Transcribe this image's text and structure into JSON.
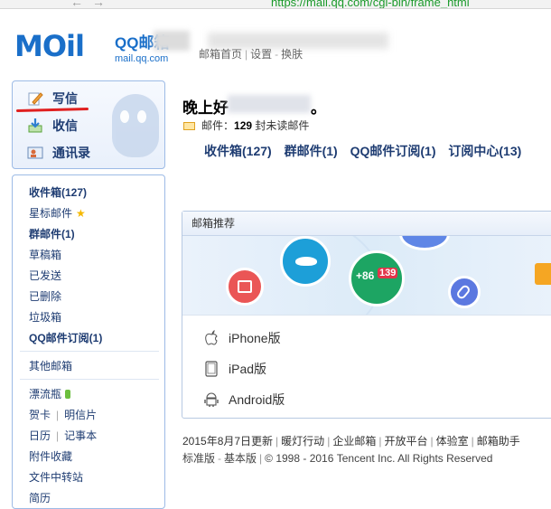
{
  "browser": {
    "url": "https://mail.qq.com/cgi-bin/frame_html"
  },
  "header": {
    "logo_text": "MOil",
    "brand_title": "QQ邮箱",
    "brand_domain": "mail.qq.com",
    "links": [
      "邮箱首页",
      "设置",
      "换肤"
    ]
  },
  "sidebar": {
    "actions": [
      {
        "label": "写信",
        "icon": "compose-icon"
      },
      {
        "label": "收信",
        "icon": "inbox-icon"
      },
      {
        "label": "通讯录",
        "icon": "contacts-icon"
      }
    ],
    "folders": [
      {
        "label": "收件箱(127)",
        "bold": true
      },
      {
        "label": "星标邮件",
        "icon": "star-icon"
      },
      {
        "label": "群邮件(1)",
        "bold": true
      },
      {
        "label": "草稿箱"
      },
      {
        "label": "已发送"
      },
      {
        "label": "已删除"
      },
      {
        "label": "垃圾箱"
      },
      {
        "label": "QQ邮件订阅(1)",
        "bold": true
      }
    ],
    "other_mailbox": "其他邮箱",
    "extras": {
      "drift_bottle": "漂流瓶",
      "card": "贺卡",
      "postcard": "明信片",
      "calendar": "日历",
      "notebook": "记事本",
      "attachments": "附件收藏",
      "transfer": "文件中转站",
      "more": "简历"
    }
  },
  "main": {
    "greeting": "晚上好",
    "greeting_end": "。",
    "mail_label": "邮件：",
    "unread_count": "129",
    "unread_suffix": "封未读邮件",
    "quick_links": [
      "收件箱(127)",
      "群邮件(1)",
      "QQ邮件订阅(1)",
      "订阅中心(13)"
    ],
    "recommend_title": "邮箱推荐",
    "banner_phone": "+86",
    "banner_badge": "139",
    "devices": [
      {
        "label": "iPhone版",
        "icon": "apple-icon"
      },
      {
        "label": "iPad版",
        "icon": "ipad-icon"
      },
      {
        "label": "Android版",
        "icon": "android-icon"
      }
    ]
  },
  "footer": {
    "line1": [
      "2015年8月7日更新",
      "暖灯行动",
      "企业邮箱",
      "开放平台",
      "体验室",
      "邮箱助手"
    ],
    "line2_links": [
      "标准版",
      "基本版"
    ],
    "copyright": "© 1998 - 2016 Tencent Inc. All Rights Reserved"
  },
  "colors": {
    "brand_blue": "#1a6fc9",
    "nav_text": "#1e3c72",
    "sidebar_border": "#9dbbe6",
    "underline_red": "#e02020"
  }
}
